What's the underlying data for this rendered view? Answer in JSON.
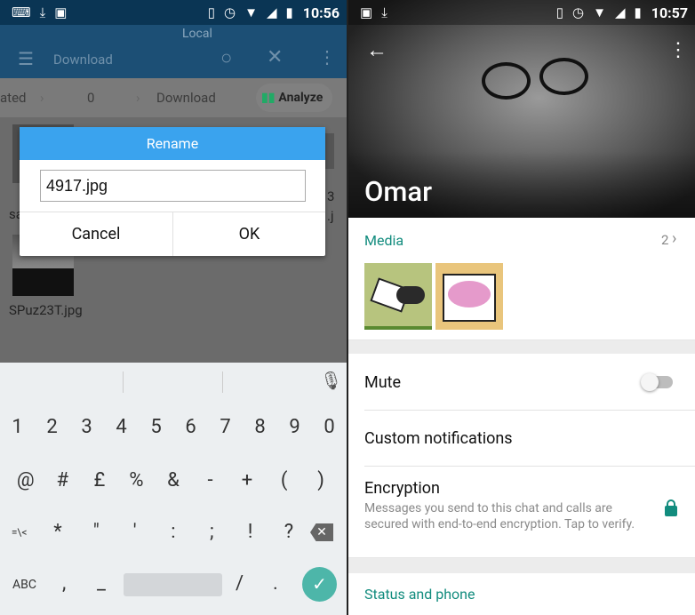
{
  "left": {
    "status_bar": {
      "time": "10:56",
      "icons": [
        "keyboard-icon",
        "download-icon",
        "image-icon",
        "vibrate-icon",
        "alarm-icon",
        "wifi-icon",
        "signal-icon",
        "battery-icon"
      ]
    },
    "app_bar": {
      "location": "Local",
      "title": "Download"
    },
    "breadcrumb": {
      "items": [
        "ated",
        "0",
        "Download"
      ],
      "analyze_label": "Analyze"
    },
    "files": [
      {
        "name": "sa"
      },
      {
        "name": "3\n.j"
      },
      {
        "name": "SPuz23T.jpg"
      }
    ],
    "dialog": {
      "title": "Rename",
      "input_value": "4917.jpg",
      "cancel_label": "Cancel",
      "ok_label": "OK",
      "accent": "#3aa3ee"
    },
    "keyboard": {
      "row1": [
        "1",
        "2",
        "3",
        "4",
        "5",
        "6",
        "7",
        "8",
        "9",
        "0"
      ],
      "row2": [
        "@",
        "#",
        "£",
        "%",
        "&",
        "-",
        "+",
        "(",
        ")"
      ],
      "row3": [
        "=\\<",
        "*",
        "\"",
        "'",
        ":",
        ";",
        "!",
        "?"
      ],
      "row4_abc": "ABC",
      "row4_keys": [
        ",",
        "_"
      ],
      "row4_keys2": [
        "/",
        "."
      ],
      "enter_color": "#4db6a9"
    }
  },
  "right": {
    "status_bar": {
      "time": "10:57"
    },
    "contact_name": "Omar",
    "media": {
      "label": "Media",
      "count": "2"
    },
    "rows": {
      "mute": "Mute",
      "custom": "Custom notifications",
      "encryption_title": "Encryption",
      "encryption_desc": "Messages you send to this chat and calls are secured with end-to-end encryption. Tap to verify.",
      "status": "Status and phone"
    },
    "mute_enabled": false,
    "accent": "#128c7e"
  }
}
